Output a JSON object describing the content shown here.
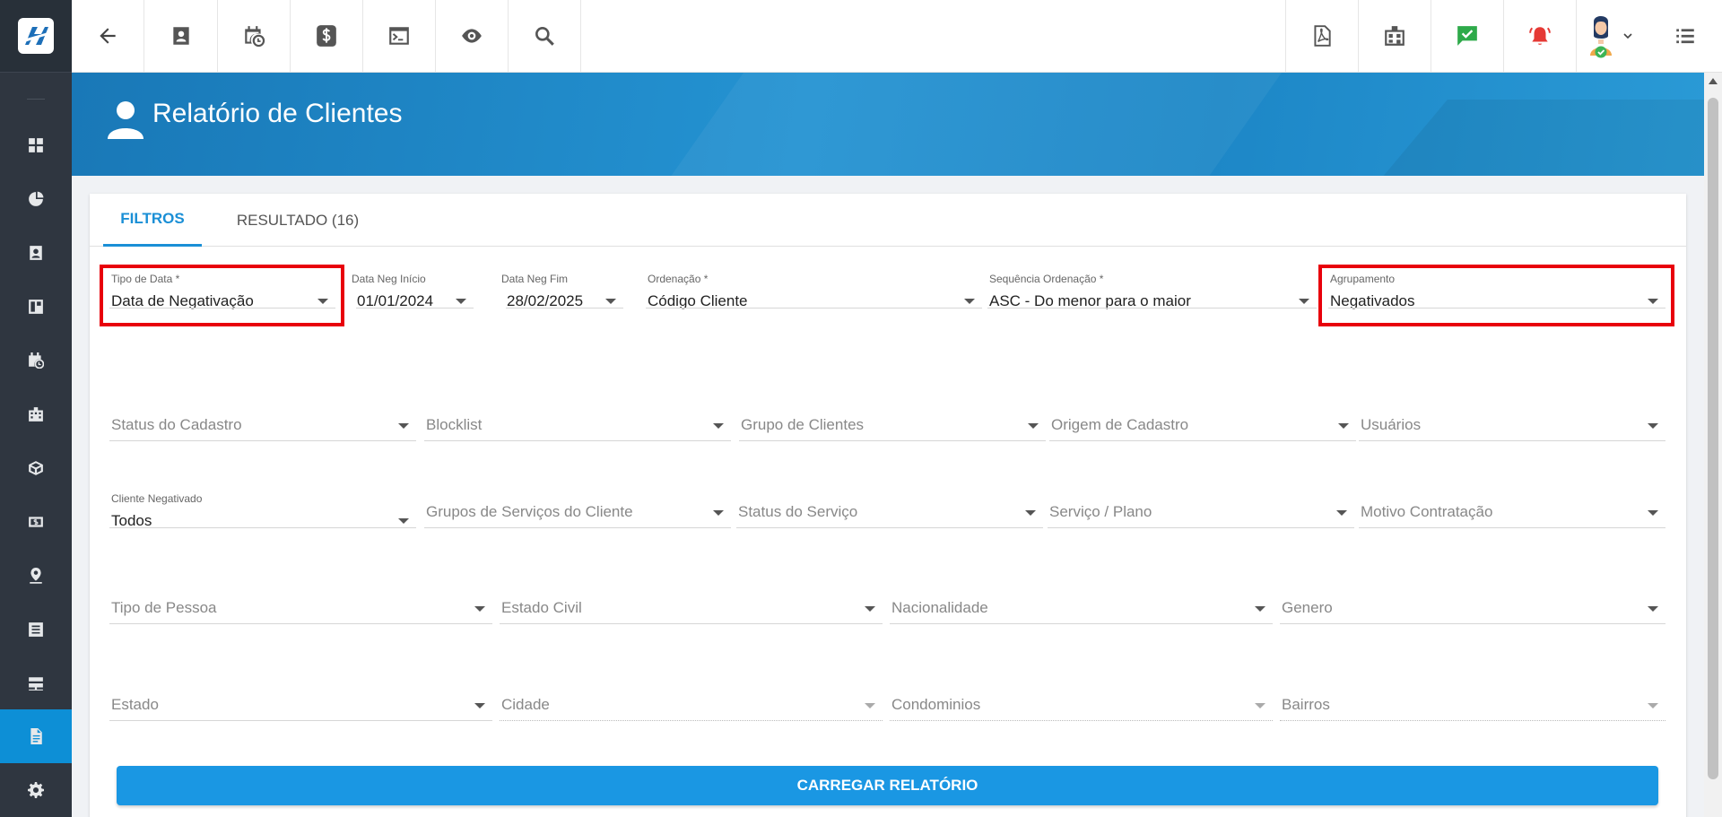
{
  "page": {
    "title": "Relatório de Clientes"
  },
  "tabs": [
    {
      "label": "FILTROS",
      "active": true
    },
    {
      "label": "RESULTADO (16)",
      "active": false
    }
  ],
  "filters_row1": {
    "tipo_data": {
      "label": "Tipo de Data *",
      "value": "Data de Negativação"
    },
    "data_inicio": {
      "label": "Data Neg Início",
      "value": "01/01/2024"
    },
    "data_fim": {
      "label": "Data Neg Fim",
      "value": "28/02/2025"
    },
    "ordenacao": {
      "label": "Ordenação *",
      "value": "Código Cliente"
    },
    "sequencia": {
      "label": "Sequência Ordenação *",
      "value": "ASC - Do menor para o maior"
    },
    "agrupamento": {
      "label": "Agrupamento",
      "value": "Negativados"
    }
  },
  "filters_row2": [
    {
      "placeholder": "Status do Cadastro"
    },
    {
      "placeholder": "Blocklist"
    },
    {
      "placeholder": "Grupo de Clientes"
    },
    {
      "placeholder": "Origem de Cadastro"
    },
    {
      "placeholder": "Usuários"
    }
  ],
  "filters_row3": {
    "cliente_negativado": {
      "label": "Cliente Negativado",
      "value": "Todos"
    },
    "others": [
      {
        "placeholder": "Grupos de Serviços do Cliente"
      },
      {
        "placeholder": "Status do Serviço"
      },
      {
        "placeholder": "Serviço / Plano"
      },
      {
        "placeholder": "Motivo Contratação"
      }
    ]
  },
  "filters_row4": [
    {
      "placeholder": "Tipo de Pessoa"
    },
    {
      "placeholder": "Estado Civil"
    },
    {
      "placeholder": "Nacionalidade"
    },
    {
      "placeholder": "Genero"
    }
  ],
  "filters_row5": [
    {
      "placeholder": "Estado"
    },
    {
      "placeholder": "Cidade"
    },
    {
      "placeholder": "Condominios"
    },
    {
      "placeholder": "Bairros"
    }
  ],
  "actions": {
    "load_label": "CARREGAR RELATÓRIO"
  },
  "sidebar": {
    "items": [
      {
        "icon": "dashboard-icon"
      },
      {
        "icon": "pie-chart-icon"
      },
      {
        "icon": "contact-card-icon"
      },
      {
        "icon": "board-icon"
      },
      {
        "icon": "calendar-clock-icon"
      },
      {
        "icon": "building-icon"
      },
      {
        "icon": "cube-icon"
      },
      {
        "icon": "money-icon"
      },
      {
        "icon": "map-pin-icon"
      },
      {
        "icon": "list-icon"
      },
      {
        "icon": "server-icon"
      },
      {
        "icon": "document-icon",
        "active": true
      },
      {
        "icon": "gear-icon"
      }
    ]
  },
  "topbar": {
    "left_icons": [
      "back-arrow-icon",
      "contact-card-icon",
      "calendar-clock-icon",
      "dollar-icon",
      "terminal-icon",
      "eye-icon",
      "search-icon"
    ],
    "right_icons": [
      "pdf-icon",
      "building-icon",
      "chat-check-icon",
      "alarm-icon",
      "avatar",
      "list-menu-icon"
    ]
  },
  "colors": {
    "accent": "#1a8fd6",
    "sidebar": "#2f3640",
    "highlight": "#e8000b",
    "alarm": "#e53935",
    "chat_check": "#2eaa4a"
  }
}
